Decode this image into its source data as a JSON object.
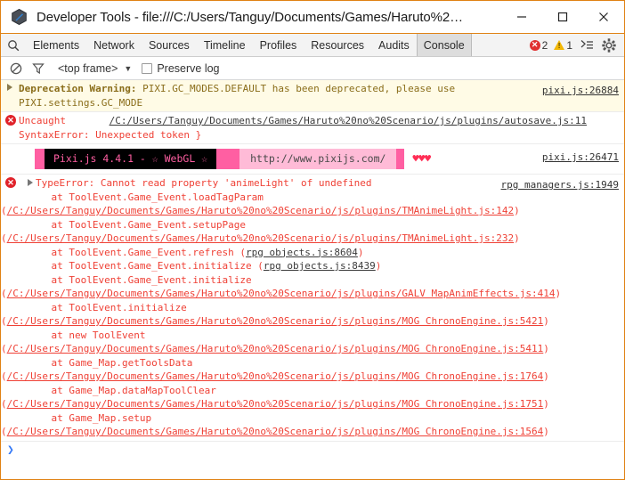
{
  "window": {
    "title": "Developer Tools - file:///C:/Users/Tanguy/Documents/Games/Haruto%2…",
    "border_color": "#e08214",
    "controls": {
      "minimize": "—",
      "maximize": "□",
      "close": "✕"
    }
  },
  "tabstrip": {
    "search_icon": "search-icon",
    "tabs": [
      {
        "label": "Elements",
        "active": false
      },
      {
        "label": "Network",
        "active": false
      },
      {
        "label": "Sources",
        "active": false
      },
      {
        "label": "Timeline",
        "active": false
      },
      {
        "label": "Profiles",
        "active": false
      },
      {
        "label": "Resources",
        "active": false
      },
      {
        "label": "Audits",
        "active": false
      },
      {
        "label": "Console",
        "active": true
      }
    ],
    "error_count": "2",
    "warning_count": "1",
    "error_glyph": "✕",
    "drawer_icon": "≥≡",
    "settings_icon": "gear-icon"
  },
  "filterbar": {
    "clear_icon": "clear-console-icon",
    "filter_icon": "filter-icon",
    "context": "<top frame>",
    "caret": "▼",
    "preserve_log_label": "Preserve log",
    "preserve_log_checked": false
  },
  "console": {
    "messages": [
      {
        "type": "warning",
        "bold_prefix": "Deprecation Warning:",
        "text": " PIXI.GC_MODES.DEFAULT has been deprecated, please use",
        "line2": "PIXI.settings.GC_MODE",
        "source": "pixi.js:26884"
      },
      {
        "type": "error",
        "label": "Uncaught",
        "link": "/C:/Users/Tanguy/Documents/Games/Haruto%20no%20Scenario/js/plugins/autosave.js:11",
        "line2": "SyntaxError: Unexpected token }"
      },
      {
        "type": "banner",
        "black_text": "Pixi.js 4.4.1 - ☆ WebGL ☆",
        "light_text": "http://www.pixijs.com/",
        "hearts": "♥♥♥",
        "source": "pixi.js:26471"
      },
      {
        "type": "error-stack",
        "headline": "TypeError: Cannot read property 'animeLight' of undefined",
        "source": "rpg managers.js:1949",
        "frames": [
          {
            "at": "    at ToolEvent.Game_Event.loadTagParam",
            "path": "/C:/Users/Tanguy/Documents/Games/Haruto%20no%20Scenario/js/plugins/TMAnimeLight.js:142",
            "wrapped": true
          },
          {
            "at": "    at ToolEvent.Game_Event.setupPage",
            "path": "/C:/Users/Tanguy/Documents/Games/Haruto%20no%20Scenario/js/plugins/TMAnimeLight.js:232",
            "wrapped": true
          },
          {
            "at": "    at ToolEvent.Game_Event.refresh ",
            "path": "rpg objects.js:8604",
            "wrapped": false
          },
          {
            "at": "    at ToolEvent.Game_Event.initialize ",
            "path": "rpg objects.js:8439",
            "wrapped": false
          },
          {
            "at": "    at ToolEvent.Game_Event.initialize",
            "path": "/C:/Users/Tanguy/Documents/Games/Haruto%20no%20Scenario/js/plugins/GALV MapAnimEffects.js:414",
            "wrapped": true
          },
          {
            "at": "    at ToolEvent.initialize",
            "path": "/C:/Users/Tanguy/Documents/Games/Haruto%20no%20Scenario/js/plugins/MOG ChronoEngine.js:5421",
            "wrapped": true
          },
          {
            "at": "    at new ToolEvent",
            "path": "/C:/Users/Tanguy/Documents/Games/Haruto%20no%20Scenario/js/plugins/MOG ChronoEngine.js:5411",
            "wrapped": true
          },
          {
            "at": "    at Game_Map.getToolsData",
            "path": "/C:/Users/Tanguy/Documents/Games/Haruto%20no%20Scenario/js/plugins/MOG ChronoEngine.js:1764",
            "wrapped": true
          },
          {
            "at": "    at Game_Map.dataMapToolClear",
            "path": "/C:/Users/Tanguy/Documents/Games/Haruto%20no%20Scenario/js/plugins/MOG ChronoEngine.js:1751",
            "wrapped": true
          },
          {
            "at": "    at Game_Map.setup",
            "path": "/C:/Users/Tanguy/Documents/Games/Haruto%20no%20Scenario/js/plugins/MOG ChronoEngine.js:1564",
            "wrapped": true
          }
        ]
      }
    ],
    "prompt_caret": "❯"
  }
}
